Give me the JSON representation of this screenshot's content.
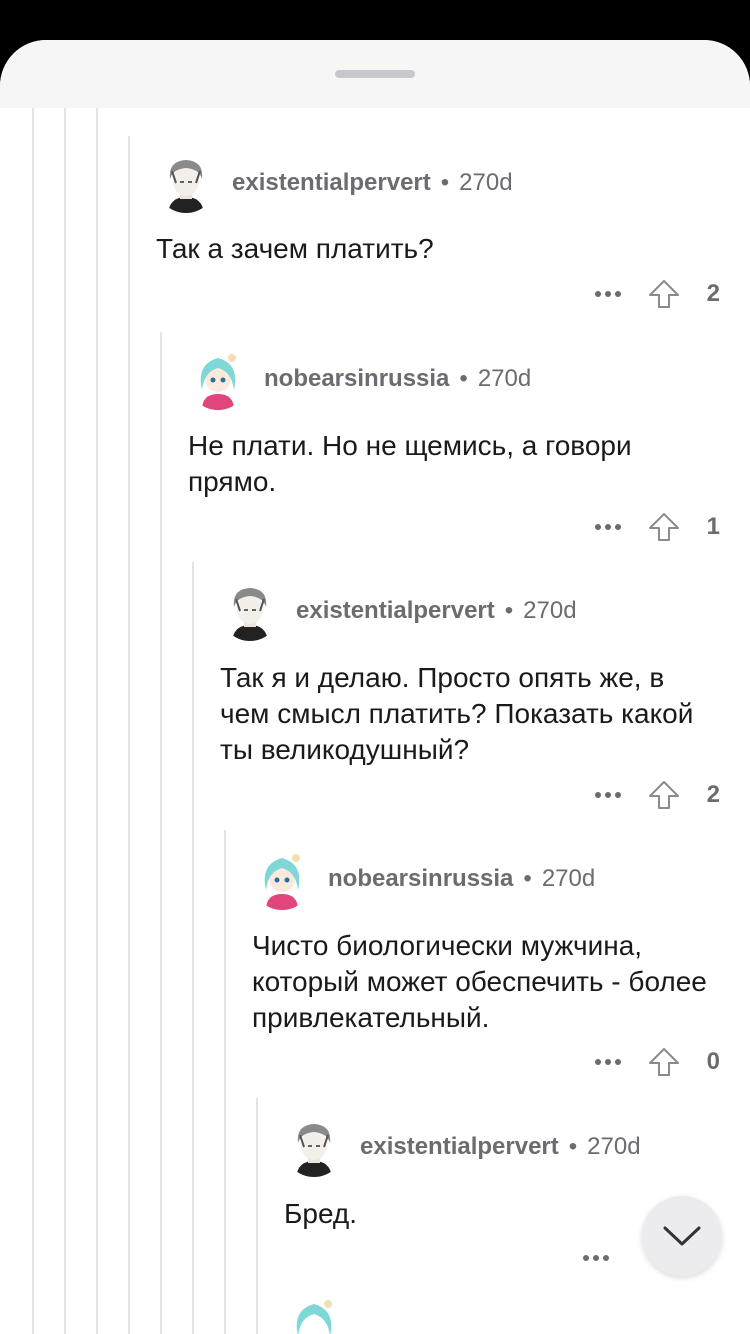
{
  "comments": [
    {
      "user": "existentialpervert",
      "age": "270d",
      "text": "Так а зачем платить?",
      "score": "2",
      "avatar": "grey-haired-avatar"
    },
    {
      "user": "nobearsinrussia",
      "age": "270d",
      "text": "Не плати. Но не щемись, а говори прямо.",
      "score": "1",
      "avatar": "teal-haired-avatar"
    },
    {
      "user": "existentialpervert",
      "age": "270d",
      "text": "Так я и делаю. Просто опять же, в чем смысл платить? Показать какой ты великодушный?",
      "score": "2",
      "avatar": "grey-haired-avatar"
    },
    {
      "user": "nobearsinrussia",
      "age": "270d",
      "text": "Чисто биологически мужчина, который может обеспечить - более привлекательный.",
      "score": "0",
      "avatar": "teal-haired-avatar"
    },
    {
      "user": "existentialpervert",
      "age": "270d",
      "text": "Бред.",
      "score": "",
      "avatar": "grey-haired-avatar"
    }
  ],
  "separator": "•",
  "icons": {
    "more": "more-dots-icon",
    "upvote": "upvote-arrow-icon",
    "scroll": "chevron-down-icon"
  }
}
